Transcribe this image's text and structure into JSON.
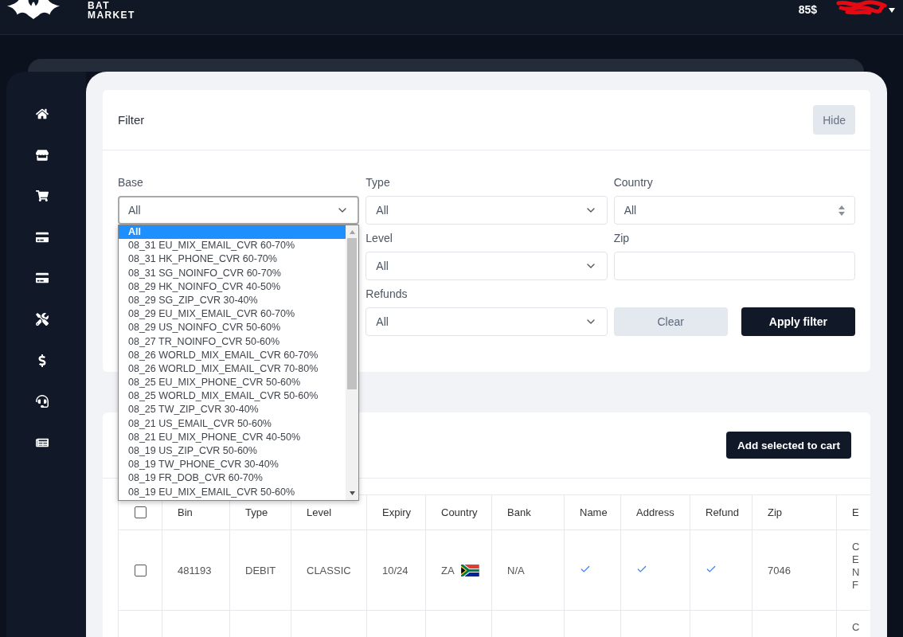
{
  "header": {
    "logo": {
      "line_1": "BAT",
      "line_2": "MARKET"
    },
    "balance": "85$"
  },
  "sidebar": {
    "items": [
      {
        "kind": "home"
      },
      {
        "kind": "store"
      },
      {
        "kind": "cart"
      },
      {
        "kind": "card"
      },
      {
        "kind": "card"
      },
      {
        "kind": "tools"
      },
      {
        "kind": "dollar"
      },
      {
        "kind": "support"
      },
      {
        "kind": "news"
      }
    ]
  },
  "filter": {
    "title": "Filter",
    "hide_button": "Hide",
    "rows": [
      {
        "fields": [
          {
            "kind": "select",
            "label": "Base",
            "value": "All",
            "focused": true,
            "options": [
              {
                "label": "All",
                "selected": true
              },
              {
                "label": "08_31 EU_MIX_EMAIL_CVR 60-70%",
                "selected": false
              },
              {
                "label": "08_31 HK_PHONE_CVR 60-70%",
                "selected": false
              },
              {
                "label": "08_31 SG_NOINFO_CVR 60-70%",
                "selected": false
              },
              {
                "label": "08_29 HK_NOINFO_CVR 40-50%",
                "selected": false
              },
              {
                "label": "08_29 SG_ZIP_CVR 30-40%",
                "selected": false
              },
              {
                "label": "08_29 EU_MIX_EMAIL_CVR 60-70%",
                "selected": false
              },
              {
                "label": "08_29 US_NOINFO_CVR 50-60%",
                "selected": false
              },
              {
                "label": "08_27 TR_NOINFO_CVR 50-60%",
                "selected": false
              },
              {
                "label": "08_26 WORLD_MIX_EMAIL_CVR 60-70%",
                "selected": false
              },
              {
                "label": "08_26 WORLD_MIX_EMAIL_CVR 70-80%",
                "selected": false
              },
              {
                "label": "08_25 EU_MIX_PHONE_CVR 50-60%",
                "selected": false
              },
              {
                "label": "08_25 WORLD_MIX_EMAIL_CVR 50-60%",
                "selected": false
              },
              {
                "label": "08_25 TW_ZIP_CVR 30-40%",
                "selected": false
              },
              {
                "label": "08_21 US_EMAIL_CVR 50-60%",
                "selected": false
              },
              {
                "label": "08_21 EU_MIX_PHONE_CVR 40-50%",
                "selected": false
              },
              {
                "label": "08_19 US_ZIP_CVR 50-60%",
                "selected": false
              },
              {
                "label": "08_19 TW_PHONE_CVR 30-40%",
                "selected": false
              },
              {
                "label": "08_19 FR_DOB_CVR 60-70%",
                "selected": false
              },
              {
                "label": "08_19 EU_MIX_EMAIL_CVR 50-60%",
                "selected": false
              }
            ]
          },
          {
            "kind": "select",
            "label": "Type",
            "value": "All",
            "focused": false
          },
          {
            "kind": "spinner",
            "label": "Country",
            "value": "All",
            "focused": false
          }
        ]
      },
      {
        "fields": [
          {
            "kind": "select",
            "label": "Level",
            "value": "All",
            "focused": false
          },
          {
            "kind": "text",
            "label": "Zip",
            "focused": false
          }
        ]
      },
      {
        "fields": [
          {
            "kind": "select",
            "label": "Refunds",
            "value": "All",
            "focused": false
          }
        ],
        "buttons": [
          {
            "kind": "secondary",
            "label": "Clear"
          },
          {
            "kind": "primary",
            "label": "Apply filter"
          }
        ]
      }
    ]
  },
  "results": {
    "add_button": "Add selected to cart",
    "table": {
      "select_all": {
        "checked": false
      },
      "columns": [
        "Bin",
        "Type",
        "Level",
        "Expiry",
        "Country",
        "Bank",
        "Name",
        "Address",
        "Refund",
        "Zip",
        "E"
      ],
      "rows": [
        {
          "checked": false,
          "cells": [
            {
              "kind": "text",
              "text": "481193"
            },
            {
              "kind": "text",
              "text": "DEBIT"
            },
            {
              "kind": "text",
              "text": "CLASSIC"
            },
            {
              "kind": "text",
              "text": "10/24"
            },
            {
              "kind": "country",
              "text": "ZA"
            },
            {
              "kind": "text",
              "text": "N/A"
            },
            {
              "kind": "tick",
              "checked": true
            },
            {
              "kind": "tick",
              "checked": true
            },
            {
              "kind": "tick",
              "checked": true
            },
            {
              "kind": "text",
              "text": "7046"
            },
            {
              "kind": "lines",
              "lines": [
                "C",
                "E",
                "N",
                "F"
              ]
            }
          ]
        },
        {
          "cells": [
            {
              "kind": "blank"
            },
            {
              "kind": "blank"
            },
            {
              "kind": "blank"
            },
            {
              "kind": "blank"
            },
            {
              "kind": "blank"
            },
            {
              "kind": "blank"
            },
            {
              "kind": "blank"
            },
            {
              "kind": "blank"
            },
            {
              "kind": "blank"
            },
            {
              "kind": "blank"
            },
            {
              "kind": "lines",
              "lines": [
                "C"
              ]
            }
          ]
        }
      ]
    }
  }
}
